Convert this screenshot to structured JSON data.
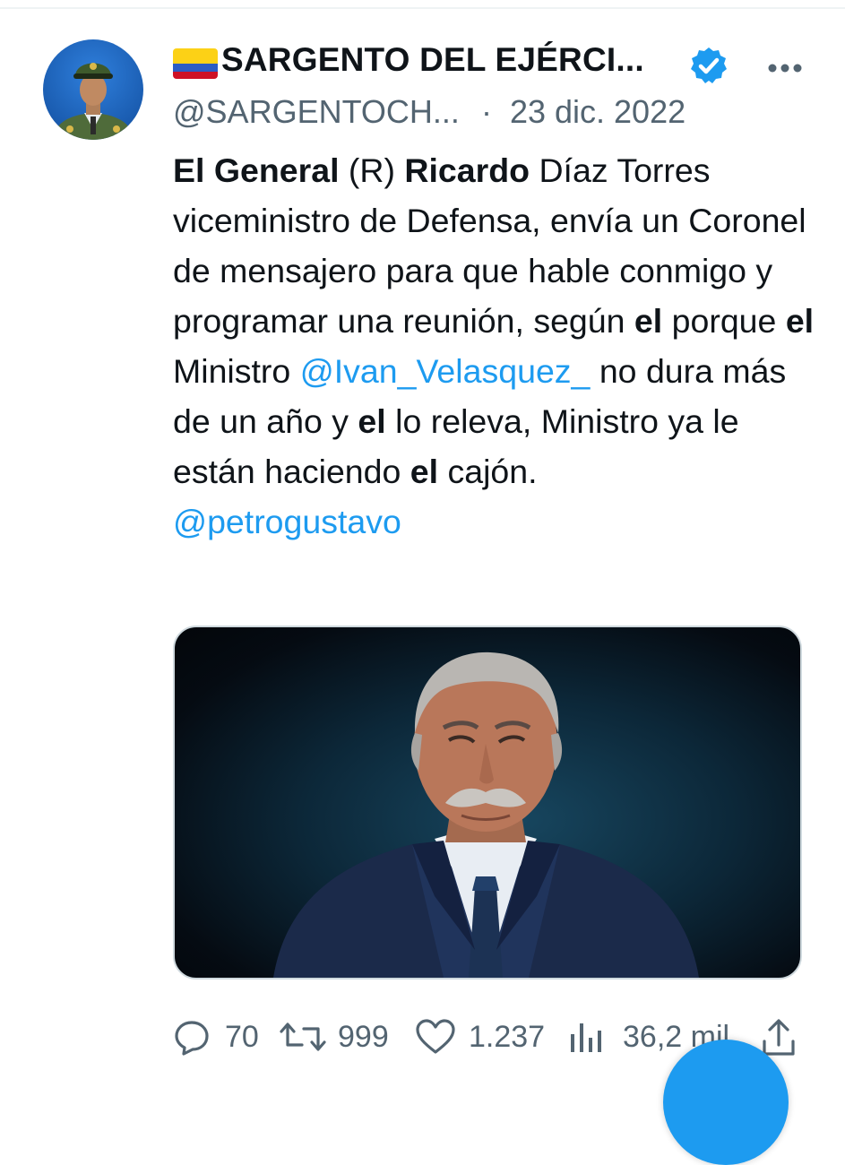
{
  "tweet": {
    "author": {
      "display_name": "SARGENTO DEL EJÉRCI...",
      "handle": "@SARGENTOCH...",
      "verified_icon": "verified-badge-icon",
      "flag_icon": "colombia-flag-icon"
    },
    "separator": "·",
    "date": "23 dic. 2022",
    "more_icon": "more-options-icon",
    "text_parts": {
      "p1": "El General",
      "p2": " (R) ",
      "p3": "Ricardo",
      "p4": " Díaz Torres viceministro de Defensa, envía un Coronel de mensajero para que hable conmigo y programar una reunión, según ",
      "p5": "el",
      "p6": " porque ",
      "p7": "el",
      "p8": " Ministro ",
      "mention1": "@Ivan_Velasquez_",
      "p9": " no dura más de un año y ",
      "p10": "el",
      "p11": " lo releva, Ministro ya le están haciendo ",
      "p12": "el",
      "p13": " cajón.",
      "mention2": "@petrogustavo"
    },
    "actions": {
      "replies": "70",
      "retweets": "999",
      "likes": "1.237",
      "views": "36,2 mil",
      "reply_icon": "reply-icon",
      "retweet_icon": "retweet-icon",
      "like_icon": "heart-icon",
      "views_icon": "views-chart-icon",
      "share_icon": "share-icon"
    }
  },
  "colors": {
    "accent": "#1d9bf0",
    "text": "#0f1419",
    "muted": "#536471"
  }
}
